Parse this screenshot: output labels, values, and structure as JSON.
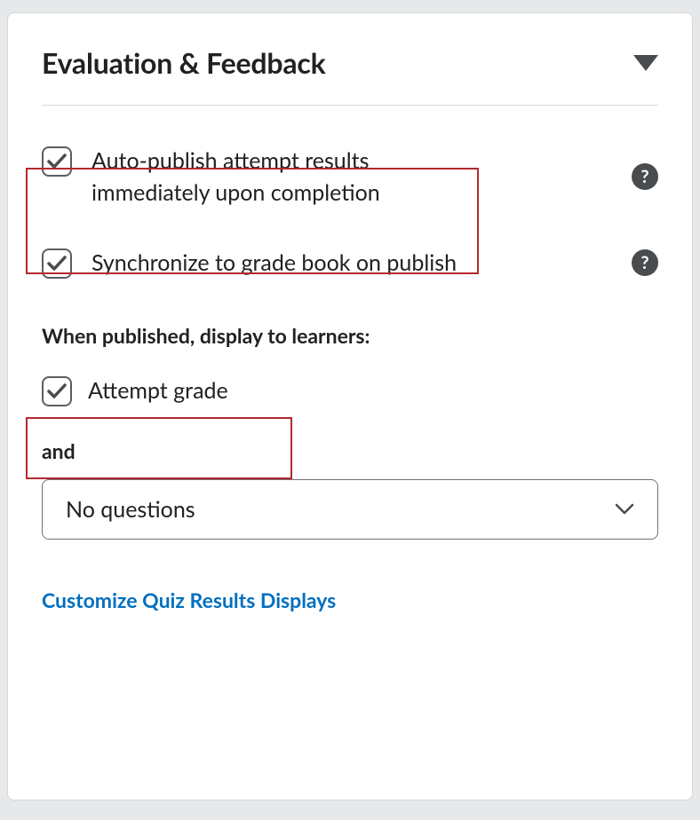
{
  "header": {
    "title": "Evaluation & Feedback"
  },
  "options": {
    "autoPublish": {
      "label": "Auto-publish attempt results immediately upon completion",
      "checked": true
    },
    "syncGradebook": {
      "label": "Synchronize to grade book on publish",
      "checked": true
    }
  },
  "displaySection": {
    "heading": "When published, display to learners:",
    "attemptGrade": {
      "label": "Attempt grade",
      "checked": true
    },
    "andLabel": "and",
    "dropdown": {
      "selected": "No questions"
    }
  },
  "links": {
    "customize": "Customize Quiz Results Displays"
  }
}
